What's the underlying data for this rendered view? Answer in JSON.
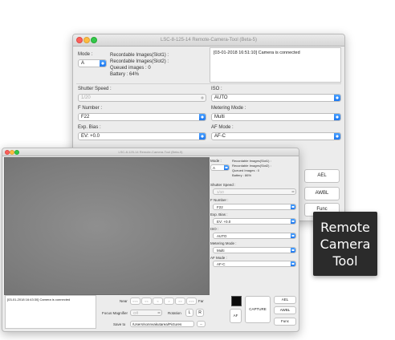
{
  "back_window": {
    "title": "LSC-8-125-14 Remote-Camera-Tool (Beta-5)",
    "mode_label": "Mode :",
    "mode_value": "A",
    "status_lines": [
      "Recordable Images(Slot1) :",
      "Recordable Images(Slot2) :",
      "Queued images : 0",
      "Battery : 64%"
    ],
    "log_text": "[03-01-2018 16:51:10] Camera is connected",
    "shutter_label": "Shutter Speed :",
    "shutter_value": "1/20",
    "iso_label": "ISO :",
    "iso_value": "AUTO",
    "fnumber_label": "F Number :",
    "fnumber_value": "F22",
    "metering_label": "Metering Mode :",
    "metering_value": "Multi",
    "expbias_label": "Exp. Bias :",
    "expbias_value": "EV: +0.0",
    "afmode_label": "AF Mode :",
    "afmode_value": "AF-C",
    "ael_label": "AEL",
    "awbl_label": "AWBL",
    "func_label": "Func"
  },
  "front_window": {
    "title": "LSC-8-125-14 Remote-Camera-Tool (Beta-5)",
    "mode_label": "Mode :",
    "mode_value": "A",
    "status_lines": [
      "Recordable Images(Slot1) :",
      "Recordable Images(Slot2) :",
      "Queued Images : 0",
      "Battery : 86%"
    ],
    "shutter_label": "Shutter Speed :",
    "shutter_value": "1/10",
    "fnumber_label": "F Number :",
    "fnumber_value": "F22",
    "expbias_label": "Exp. Bias :",
    "expbias_value": "EV: +0.0",
    "iso_label": "ISO :",
    "iso_value": "AUTO",
    "metering_label": "Metering Mode :",
    "metering_value": "Multi",
    "afmode_label": "AF Mode :",
    "afmode_value": "AF-C",
    "log_text": "[03-01-2018 16:43:30] Camera is connected",
    "near_label": "Near",
    "far_label": "Far",
    "focus_buttons": [
      "<<<",
      "<<",
      "<",
      ">",
      ">>",
      ">>>"
    ],
    "focus_mag_label": "Focus Magnifier",
    "focus_mag_value": "Off",
    "rotation_label": "Rotation",
    "rotate_left": "L",
    "rotate_right": "R",
    "save_to_label": "Save to",
    "save_path": "/Users/sonnvakutarea/Pictures",
    "browse_label": "...",
    "af_label": "AF",
    "capture_label": "CAPTURE",
    "ael_label": "AEL",
    "awbl_label": "AWBL",
    "func_label": "Func"
  },
  "badge": {
    "lines": [
      "Remote",
      "Camera",
      "Tool"
    ]
  }
}
